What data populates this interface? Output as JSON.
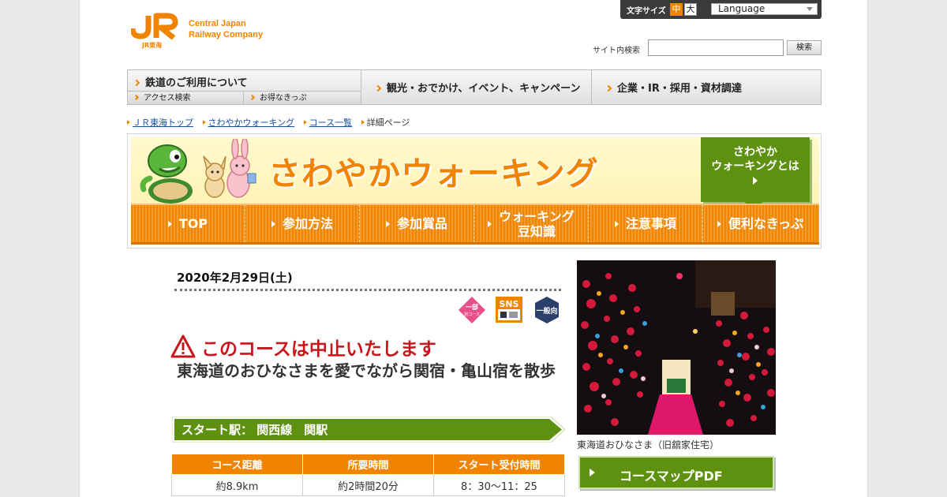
{
  "header": {
    "font_size_label": "文字サイズ",
    "font_size_medium": "中",
    "font_size_large": "大",
    "language_label": "Language",
    "logo_line1": "Central Japan",
    "logo_line2": "Railway Company",
    "logo_sub": "JR東海",
    "search_label": "サイト内検索",
    "search_value": "",
    "search_button": "検索"
  },
  "global_nav": {
    "rail_usage": "鉄道のご利用について",
    "access_search": "アクセス検索",
    "discount_tickets": "お得なきっぷ",
    "tourism": "観光・おでかけ、イベント、キャンペーン",
    "corporate": "企業・IR・採用・資材調達"
  },
  "breadcrumb": [
    "ＪＲ東海トップ",
    "さわやかウォーキング",
    "コース一覧",
    "詳細ページ"
  ],
  "banner": {
    "title": "さわやかウォーキング",
    "about_line1": "さわやか",
    "about_line2": "ウォーキングとは",
    "tabs": [
      {
        "l1": "TOP",
        "l2": ""
      },
      {
        "l1": "参加方法",
        "l2": ""
      },
      {
        "l1": "参加賞品",
        "l2": ""
      },
      {
        "l1": "ウォーキング",
        "l2": "豆知識"
      },
      {
        "l1": "注意事項",
        "l2": ""
      },
      {
        "l1": "便利なきっぷ",
        "l2": ""
      }
    ]
  },
  "course": {
    "date": "2020年2月29日(土)",
    "badges": [
      "一部 別コース",
      "SNS",
      "一般向"
    ],
    "cancel_notice": "このコースは中止いたします",
    "title": "東海道のおひなさまを愛でながら関宿・亀山宿を散歩",
    "start_station": "スタート駅： 関西線　関駅",
    "table_headers": [
      "コース距離",
      "所要時間",
      "スタート受付時間"
    ],
    "table_values": [
      "約8.9km",
      "約2時間20分",
      "8：30～11：25"
    ]
  },
  "photo": {
    "caption": "東海道おひなさま（旧舘家住宅）"
  },
  "pdf_button": "コースマップPDF",
  "colors": {
    "brand_orange": "#f08300",
    "green": "#5f9111",
    "alert_red": "#c8161d"
  }
}
